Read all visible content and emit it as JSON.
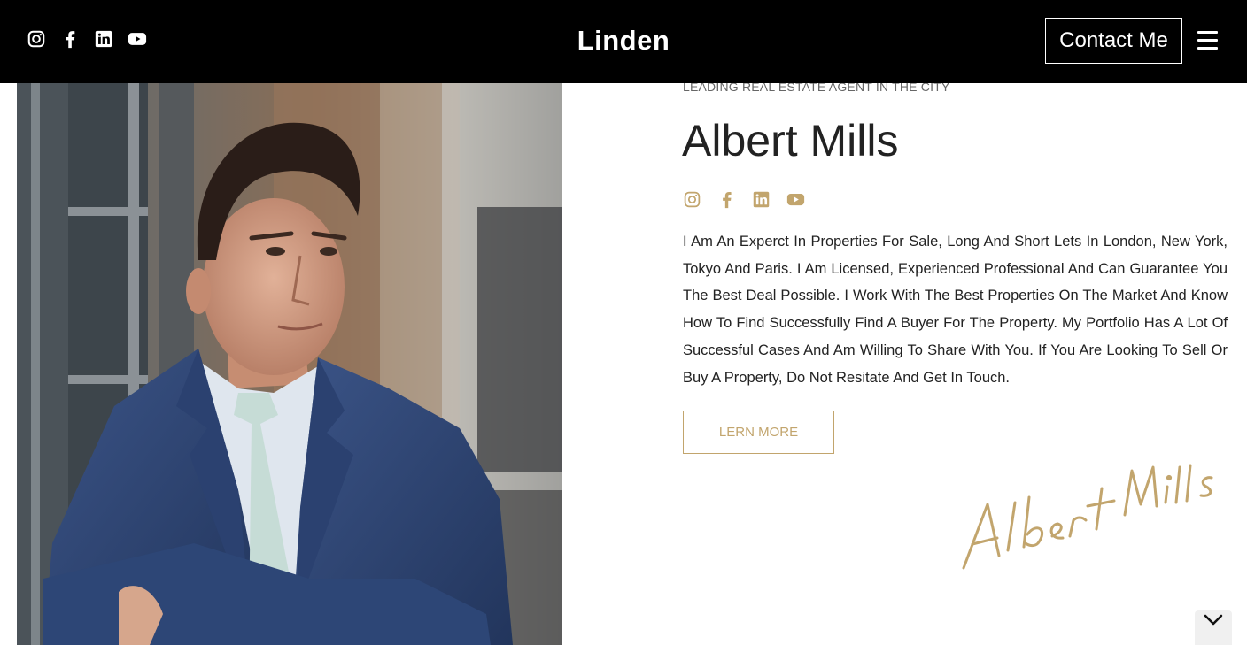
{
  "header": {
    "brand": "Linden",
    "contact_label": "Contact Me",
    "socials": [
      "instagram-icon",
      "facebook-icon",
      "linkedin-icon",
      "youtube-icon"
    ]
  },
  "hero": {
    "eyebrow": "LEADING REAL ESTATE AGENT IN THE CITY",
    "name": "Albert Mills",
    "socials": [
      "instagram-icon",
      "facebook-icon",
      "linkedin-icon",
      "youtube-icon"
    ],
    "bio": "I Am An Experct In Properties For Sale, Long And Short Lets In London, New York, Tokyo And Paris. I Am Licensed, Experienced Professional And Can Guarantee You The Best Deal Possible. I Work With The Best Properties On The Market And Know How To Find Successfully Find A Buyer For The Property. My Portfolio Has A Lot Of Successful Cases And Am Willing To Share With You. If You Are Looking To Sell Or Buy A Property, Do Not Resitate And Get In Touch.",
    "learn_label": "LERN MORE",
    "signature": "Albert Mills"
  },
  "colors": {
    "header_bg": "#000000",
    "accent_gold": "#c2a56d",
    "text_dark": "#222222"
  },
  "icons": {
    "menu": "hamburger-icon",
    "scroll": "chevron-down-icon"
  }
}
